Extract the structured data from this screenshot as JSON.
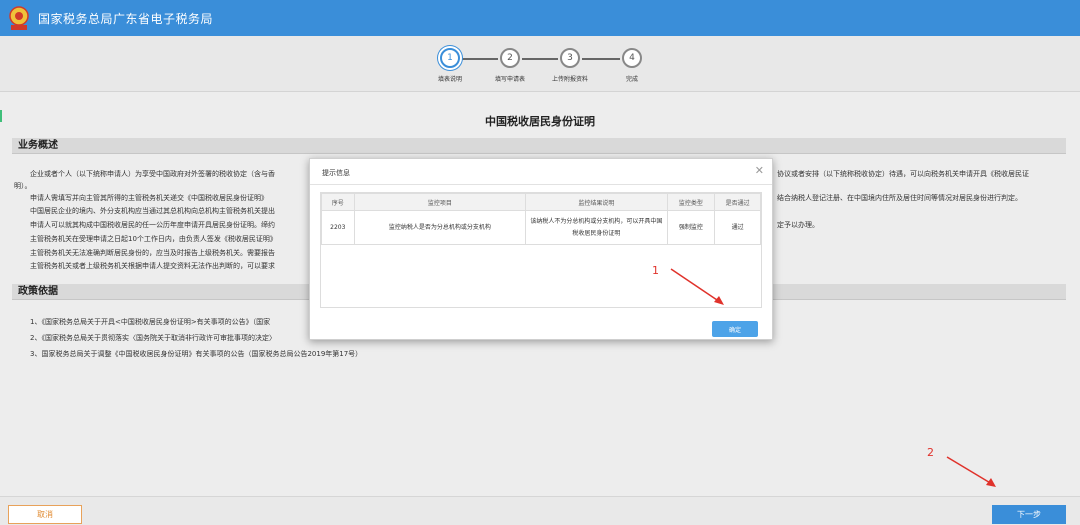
{
  "header": {
    "title": "国家税务总局广东省电子税务局",
    "logo_icon": "tax-bureau-emblem-icon",
    "bg_color": "#3a8ed9"
  },
  "steps": [
    {
      "num": "1",
      "label": "填表说明",
      "active": true
    },
    {
      "num": "2",
      "label": "填写申请表",
      "active": false
    },
    {
      "num": "3",
      "label": "上传附报资料",
      "active": false
    },
    {
      "num": "4",
      "label": "完成",
      "active": false
    }
  ],
  "page": {
    "title": "中国税收居民身份证明",
    "section1": "业务概述",
    "section2": "政策依据",
    "overview": [
      "企业或者个人（以下统称申请人）为享受中国政府对外签署的税收协定（含与香",
      "明）。",
      "申请人需填写并向主管其所得的主管税务机关递交《中国税收居民身份证明》",
      "中国居民企业的境内、外分支机构应当通过其总机构向总机构主管税务机关提出",
      "申请人可以就其构成中国税收居民的任一公历年度申请开具居民身份证明。缔约",
      "主管税务机关在受理申请之日起10个工作日内，由负责人签发《税收居民证明》",
      "主管税务机关无法准确判断居民身份的，应当及时报告上级税务机关。需要报告",
      "主管税务机关或者上级税务机关根据申请人提交资料无法作出判断的，可以要求"
    ],
    "overview_right": [
      "协议或者安排（以下统称税收协定）待遇，可以向税务机关申请开具《税收居民证",
      "结合纳税人登记注册、在中国境内住所及居住时间等情况对居民身份进行判定。",
      "定予以办理。"
    ],
    "policies": [
      "1、《国家税务总局关于开具<中国税收居民身份证明>有关事项的公告》（国家",
      "2、《国家税务总局关于贯彻落实〈国务院关于取消非行政许可审批事项的决定〉",
      "3、国家税务总局关于调整《中国税收居民身份证明》有关事项的公告（国家税务总局公告2019年第17号）"
    ]
  },
  "dialog": {
    "title": "提示信息",
    "close_icon": "close-icon",
    "columns": [
      "序号",
      "监控项目",
      "监控结果说明",
      "监控类型",
      "是否通过"
    ],
    "rows": [
      {
        "id": "2203",
        "item": "监控纳税人是否为分总机构或分支机构",
        "result": "该纳税人不为分总机构或分支机构，可以开具中国税收居民身份证明",
        "type": "强制监控",
        "pass": "通过"
      }
    ],
    "ok_label": "确定"
  },
  "annotations": [
    {
      "num": "1",
      "color": "#e0322b"
    },
    {
      "num": "2",
      "color": "#e0322b"
    }
  ],
  "footer": {
    "cancel_label": "取消",
    "next_label": "下一步"
  }
}
